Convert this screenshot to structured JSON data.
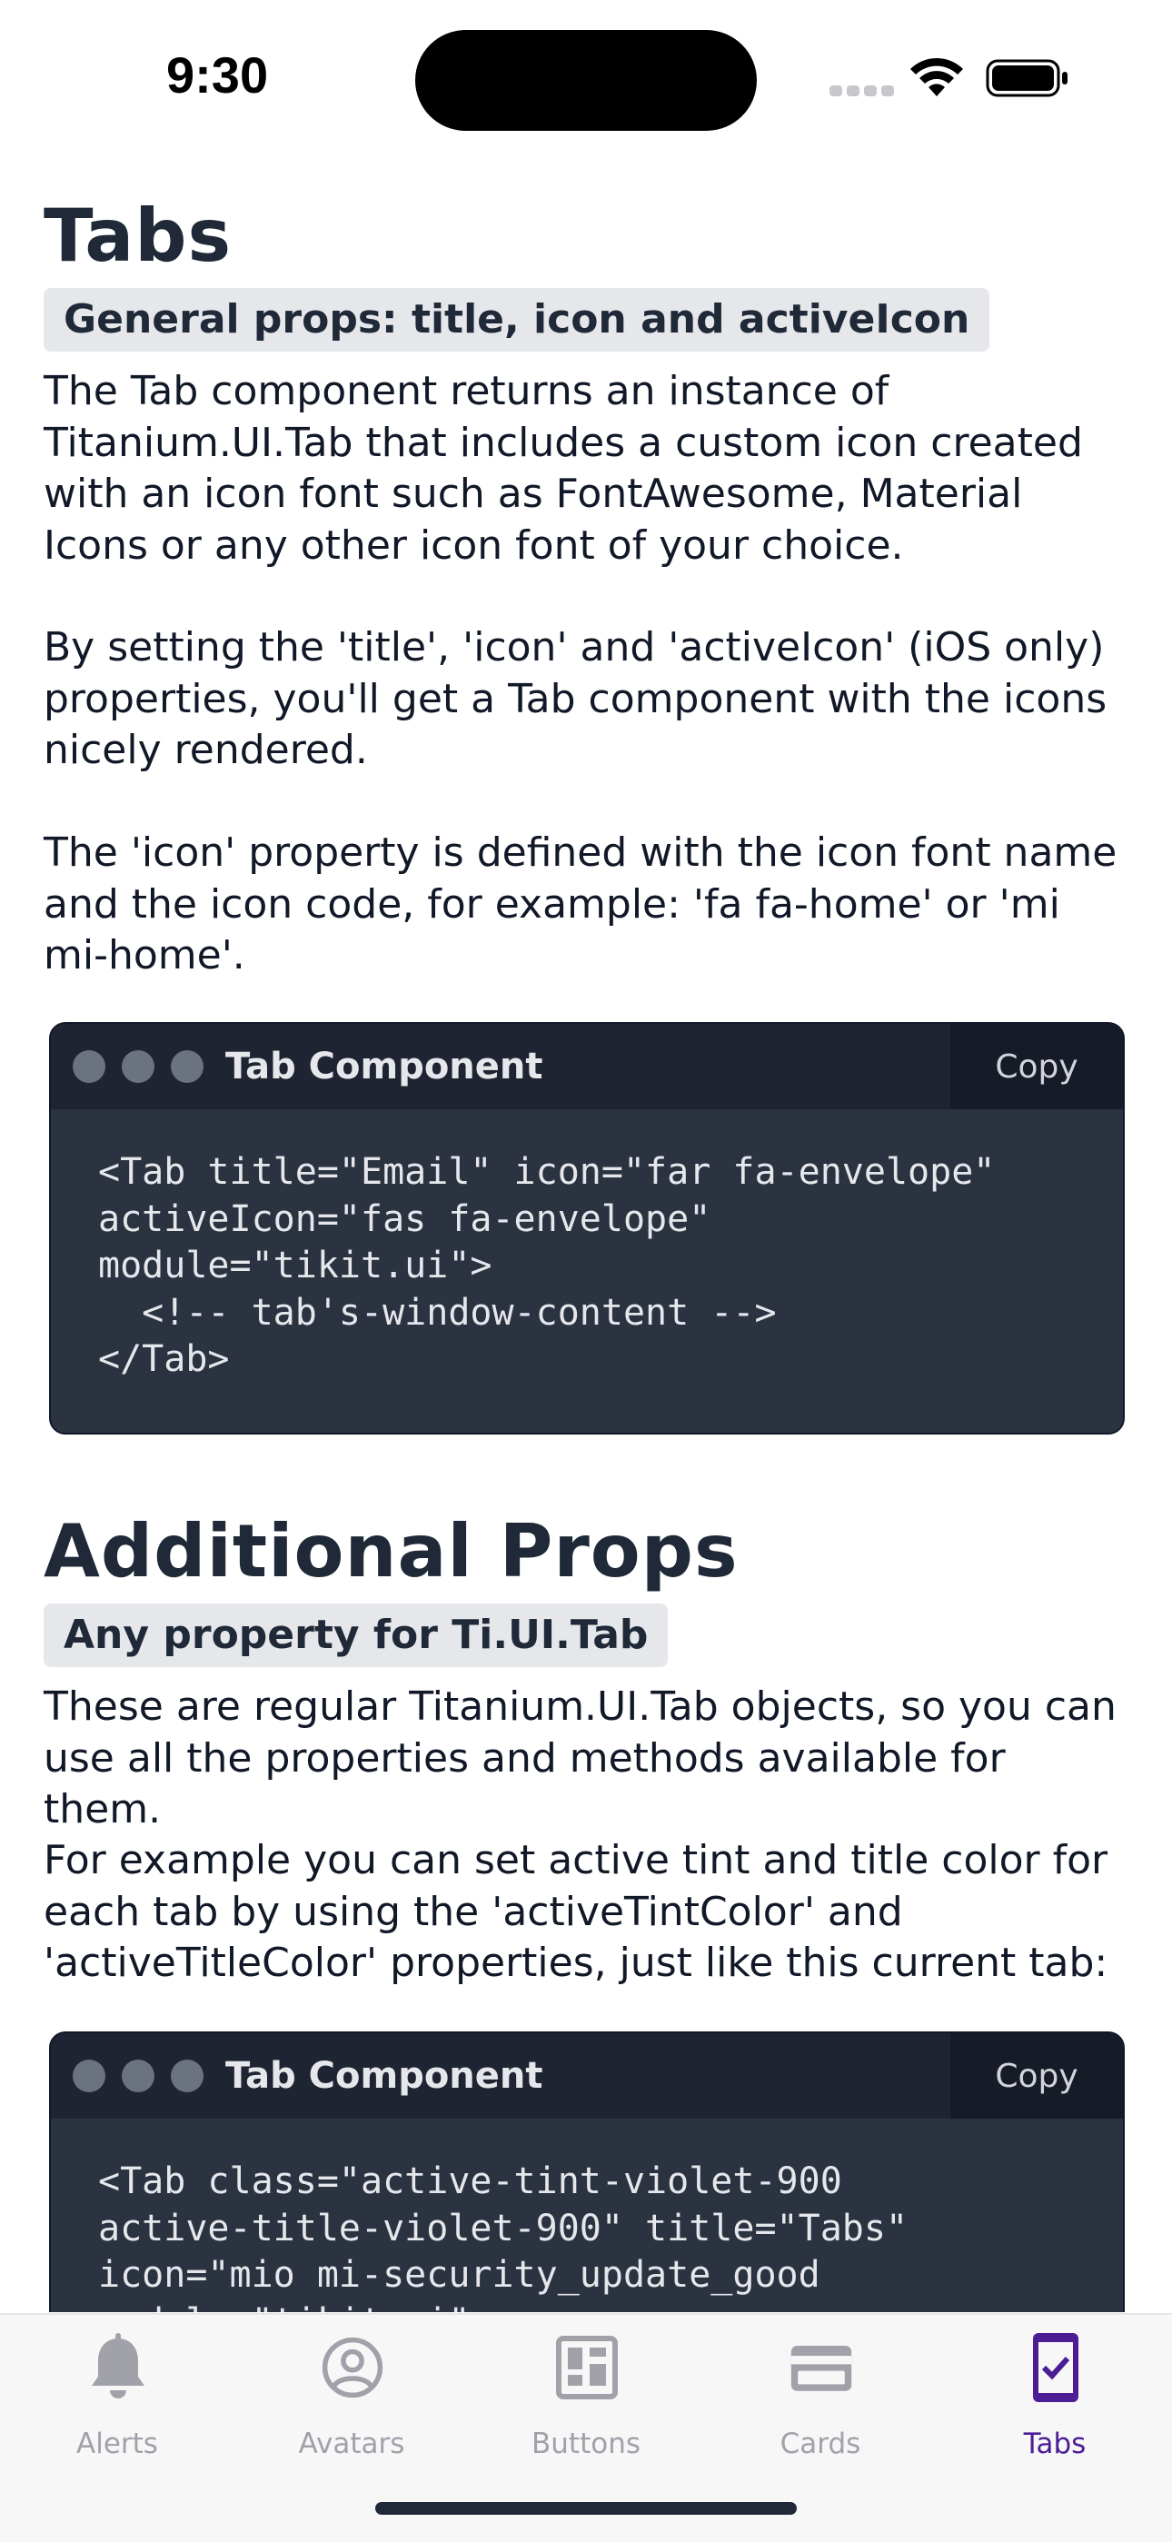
{
  "status_bar": {
    "time": "9:30"
  },
  "section1": {
    "heading": "Tabs",
    "subtitle": "General props: title, icon and activeIcon",
    "paragraphs": [
      "The Tab component returns an instance of Titanium.UI.Tab that includes a custom icon created with an icon font such as FontAwesome, Material Icons or any other icon font of your choice.",
      "By setting the 'title', 'icon' and 'activeIcon' (iOS only) properties, you'll get a Tab component with the icons nicely rendered.",
      "The 'icon' property is defined with the icon font name and the icon code, for example: 'fa fa-home' or 'mi mi-home'."
    ],
    "code_card": {
      "title": "Tab Component",
      "copy_label": "Copy",
      "code": "<Tab title=\"Email\" icon=\"far fa-envelope\"\nactiveIcon=\"fas fa-envelope\"\nmodule=\"tikit.ui\">\n  <!-- tab's-window-content -->\n</Tab>"
    }
  },
  "section2": {
    "heading": "Additional Props",
    "subtitle": "Any property for Ti.UI.Tab",
    "paragraphs": [
      "These are regular Titanium.UI.Tab objects, so you can use all the properties and methods available for them.",
      "For example you can set active tint and title color for each tab by using the 'activeTintColor' and 'activeTitleColor' properties, just like this current tab:"
    ],
    "code_card": {
      "title": "Tab Component",
      "copy_label": "Copy",
      "code": "<Tab class=\"active-tint-violet-900\nactive-title-violet-900\" title=\"Tabs\"\nicon=\"mio mi-security_update_good\nmodule=\"tikit.ui\">"
    }
  },
  "tab_bar": {
    "tabs": [
      {
        "label": "Alerts",
        "icon": "bell-icon",
        "active": false
      },
      {
        "label": "Avatars",
        "icon": "user-circle-icon",
        "active": false
      },
      {
        "label": "Buttons",
        "icon": "dashboard-icon",
        "active": false
      },
      {
        "label": "Cards",
        "icon": "credit-card-icon",
        "active": false
      },
      {
        "label": "Tabs",
        "icon": "mobile-check-icon",
        "active": true
      }
    ],
    "active_color": "#4c1d95",
    "inactive_color": "#a1a1aa"
  }
}
